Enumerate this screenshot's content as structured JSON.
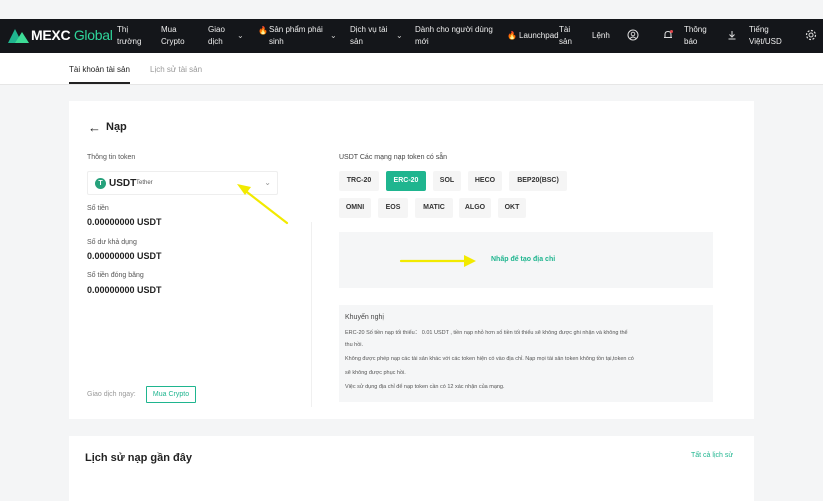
{
  "brand": {
    "name": "MEXC",
    "suffix": "Global"
  },
  "nav": {
    "markets": "Thị trường",
    "buy_crypto": "Mua Crypto",
    "trade": "Giao dịch",
    "derivatives": "Sản phẩm phái sinh",
    "financial": "Dịch vụ tài sản",
    "new_users": "Dành cho người dùng mới",
    "launchpad": "Launchpad",
    "assets": "Tài sản",
    "orders": "Lệnh",
    "notifications": "Thông báo",
    "language": "Tiếng Việt/USD"
  },
  "subnav": {
    "account": "Tài khoản tài sản",
    "history": "Lịch sử tài sản"
  },
  "page": {
    "title": "Nạp"
  },
  "token": {
    "section_label": "Thông tin token",
    "symbol": "USDT",
    "name": "Tether",
    "amount_label": "Số tiền",
    "amount_value": "0.00000000 USDT",
    "available_label": "Số dư khả dụng",
    "available_value": "0.00000000 USDT",
    "frozen_label": "Số tiền đóng băng",
    "frozen_value": "0.00000000 USDT"
  },
  "trade_now": {
    "label": "Giao dịch ngay:",
    "button": "Mua Crypto"
  },
  "networks": {
    "label": "USDT Các mạng nạp token có sẵn",
    "items": [
      "TRC-20",
      "ERC-20",
      "SOL",
      "HECO",
      "BEP20(BSC)",
      "OMNI",
      "EOS",
      "MATIC",
      "ALGO",
      "OKT"
    ],
    "selected": "ERC-20"
  },
  "address": {
    "generate_link": "Nhấp để tạo địa chỉ"
  },
  "recommendation": {
    "title": "Khuyến nghị",
    "lines": [
      "ERC-20 Số tiền nạp tối thiểu：  0.01 USDT , tiền nạp nhỏ hơn số tiền tối thiểu sẽ không được ghi nhận và không thể",
      "thu hồi.",
      "Không được phép nạp các tài sản khác với các token hiện có vào địa chỉ. Nạp mọi tài sản token không tồn tại,token có",
      "sẽ không được phục hồi.",
      "Việc sử dụng địa chỉ để nạp token cần có 12 xác nhận của mạng."
    ]
  },
  "history": {
    "title": "Lịch sử nạp gần đây",
    "all_link": "Tất cả lịch sử"
  },
  "colors": {
    "accent": "#1fb58f",
    "nav_bg": "#14161a",
    "annotation": "#f2ea00"
  },
  "icons": [
    "tether-icon",
    "back-arrow-icon",
    "chevron-down-icon",
    "user-icon",
    "bell-icon",
    "download-icon",
    "settings-icon",
    "fire-icon"
  ]
}
